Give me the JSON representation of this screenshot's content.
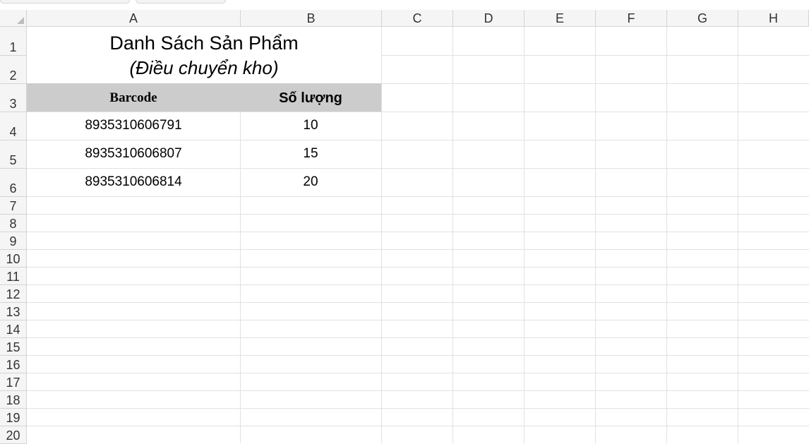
{
  "columns": [
    "A",
    "B",
    "C",
    "D",
    "E",
    "F",
    "G",
    "H"
  ],
  "rows": [
    "1",
    "2",
    "3",
    "4",
    "5",
    "6",
    "7",
    "8",
    "9",
    "10",
    "11",
    "12",
    "13",
    "14",
    "15",
    "16",
    "17",
    "18",
    "19",
    "20"
  ],
  "sheet": {
    "title": "Danh Sách Sản Phẩm",
    "subtitle": "(Điều chuyển kho)",
    "header": {
      "barcode": "Barcode",
      "quantity": "Số lượng"
    },
    "items": [
      {
        "barcode": "8935310606791",
        "quantity": "10"
      },
      {
        "barcode": "8935310606807",
        "quantity": "15"
      },
      {
        "barcode": "8935310606814",
        "quantity": "20"
      }
    ]
  },
  "colors": {
    "header_fill": "#cccccc",
    "gridline": "#e1e1e1",
    "headers_bg": "#f5f5f5"
  }
}
